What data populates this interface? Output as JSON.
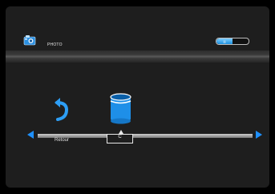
{
  "header": {
    "title": "PHOTO",
    "icon": "camera-icon",
    "battery": {
      "level": 0.5,
      "label": "|||"
    }
  },
  "menu": {
    "items": [
      {
        "label": "Retour",
        "icon": "back-arrow-icon"
      },
      {
        "label": "C",
        "icon": "drive-icon"
      }
    ],
    "selected_index": 1
  },
  "colors": {
    "accent": "#1e90ff",
    "background": "#1e1e1e"
  }
}
